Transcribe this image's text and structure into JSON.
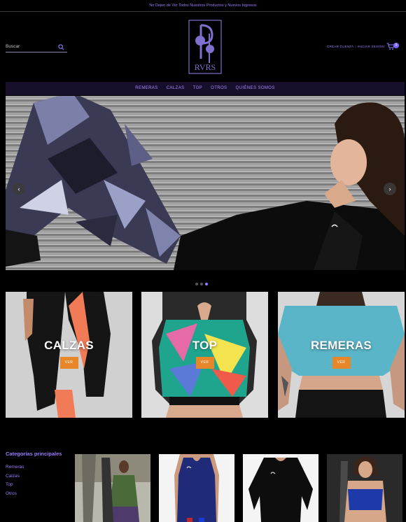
{
  "announcement": "No Dejen de Ver Todos Nuestros Productos y Nuevos Ingresos",
  "header": {
    "search_placeholder": "Buscar",
    "logo_text": "RVRS",
    "create_account": "CREAR CUENTA",
    "login": "INICIAR SESIÓN",
    "cart_count": "0"
  },
  "nav": [
    "REMERAS",
    "CALZAS",
    "TOP",
    "OTROS",
    "QUIÉNES SOMOS"
  ],
  "hero": {
    "slides": 3,
    "active_slide": 3
  },
  "categories": [
    {
      "title": "CALZAS",
      "button": "VER"
    },
    {
      "title": "TOP",
      "button": "VER"
    },
    {
      "title": "REMERAS",
      "button": "VER"
    }
  ],
  "sidebar": {
    "title": "Categorías principales",
    "links": [
      "Remeras",
      "Calzas",
      "Top",
      "Otros"
    ]
  },
  "colors": {
    "accent": "#9d7cff",
    "button": "#e8862a",
    "nav_bg": "#160e2a"
  }
}
